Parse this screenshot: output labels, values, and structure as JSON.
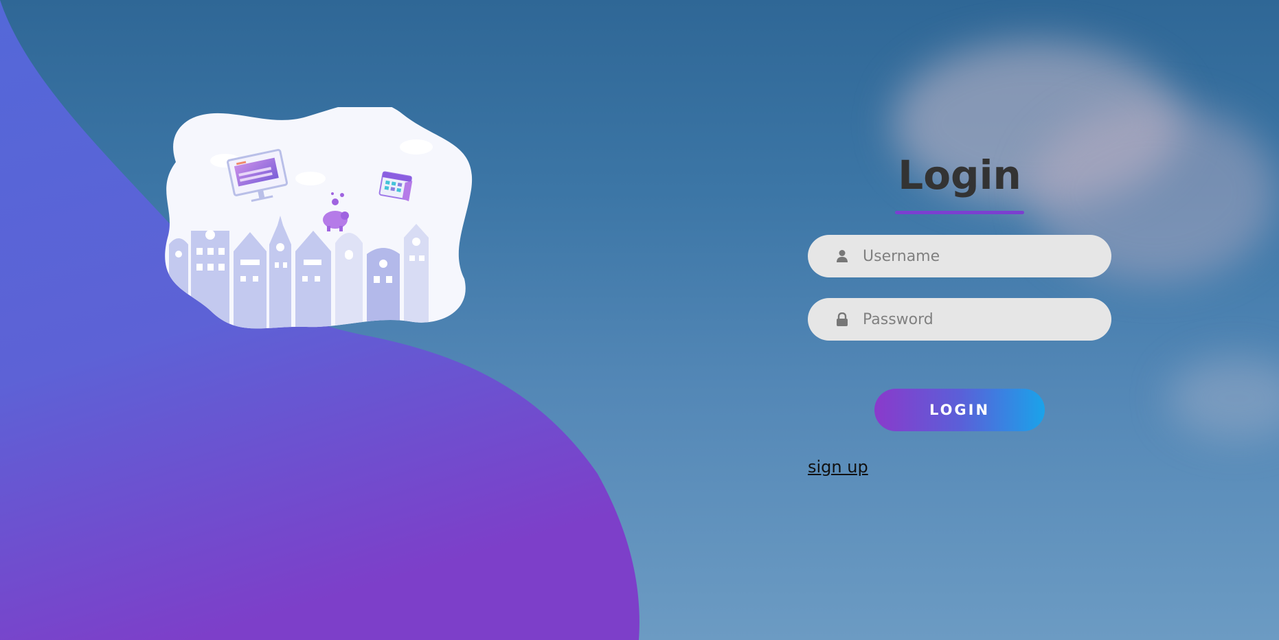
{
  "login": {
    "title": "Login",
    "username_placeholder": "Username",
    "password_placeholder": "Password",
    "submit_label": "LOGIN",
    "signup_label": "sign up"
  },
  "icons": {
    "username": "user-icon",
    "password": "lock-icon"
  },
  "colors": {
    "accent": "#7b3fd0",
    "button_gradient_start": "#8a3acb",
    "button_gradient_end": "#1aa3ea",
    "wave_top": "#5468d8",
    "wave_bottom": "#7d3fc9",
    "field_background": "#e6e6e6",
    "title_text": "#333333"
  }
}
